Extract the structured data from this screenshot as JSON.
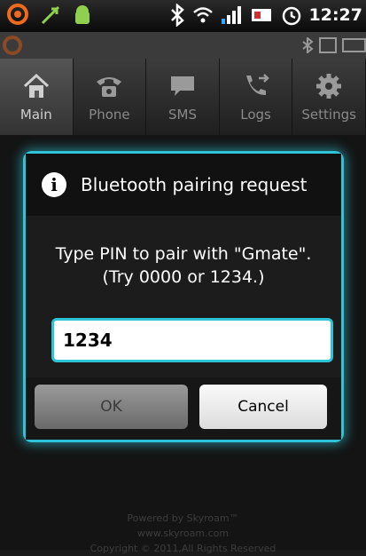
{
  "status_bar": {
    "time": "12:27"
  },
  "tabs": [
    {
      "label": "Main",
      "icon": "home-icon",
      "active": true
    },
    {
      "label": "Phone",
      "icon": "phone-icon",
      "active": false
    },
    {
      "label": "SMS",
      "icon": "sms-icon",
      "active": false
    },
    {
      "label": "Logs",
      "icon": "logs-icon",
      "active": false
    },
    {
      "label": "Settings",
      "icon": "gear-icon",
      "active": false
    }
  ],
  "dialog": {
    "title": "Bluetooth pairing request",
    "message_line1": "Type PIN to pair with \"Gmate\".",
    "message_line2": "(Try 0000 or 1234.)",
    "pin_value": "1234",
    "ok_label": "OK",
    "cancel_label": "Cancel"
  },
  "footer": {
    "powered": "Powered by Skyroam™",
    "url": "www.skyroam.com",
    "copyright": "Copyright © 2011,All Rights Reserved"
  },
  "colors": {
    "accent": "#2ec3d6"
  }
}
